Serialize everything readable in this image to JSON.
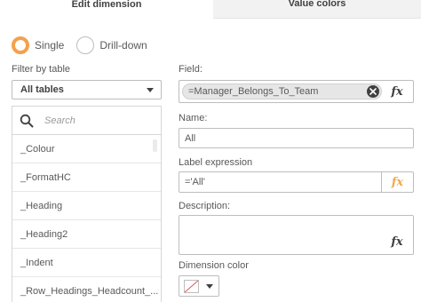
{
  "tabs": [
    {
      "label": "Edit dimension",
      "active": true
    },
    {
      "label": "Value colors",
      "active": false
    }
  ],
  "dimension_type": {
    "options": [
      "Single",
      "Drill-down"
    ],
    "selected": "Single"
  },
  "filter": {
    "label": "Filter by table",
    "selected": "All tables"
  },
  "field_list": {
    "search_placeholder": "Search",
    "items": [
      "_Colour",
      "_FormatHC",
      "_Heading",
      "_Heading2",
      "_Indent",
      "_Row_Headings_Headcount_..."
    ]
  },
  "field": {
    "label": "Field:",
    "value": "=Manager_Belongs_To_Team"
  },
  "name": {
    "label": "Name:",
    "value": "All"
  },
  "label_expression": {
    "label": "Label expression",
    "value": "='All'"
  },
  "description": {
    "label": "Description:",
    "value": ""
  },
  "dimension_color": {
    "label": "Dimension color"
  },
  "fx_label": "fx",
  "colors": {
    "accent": "#f5a04a",
    "fx_active": "#f2a94a"
  }
}
